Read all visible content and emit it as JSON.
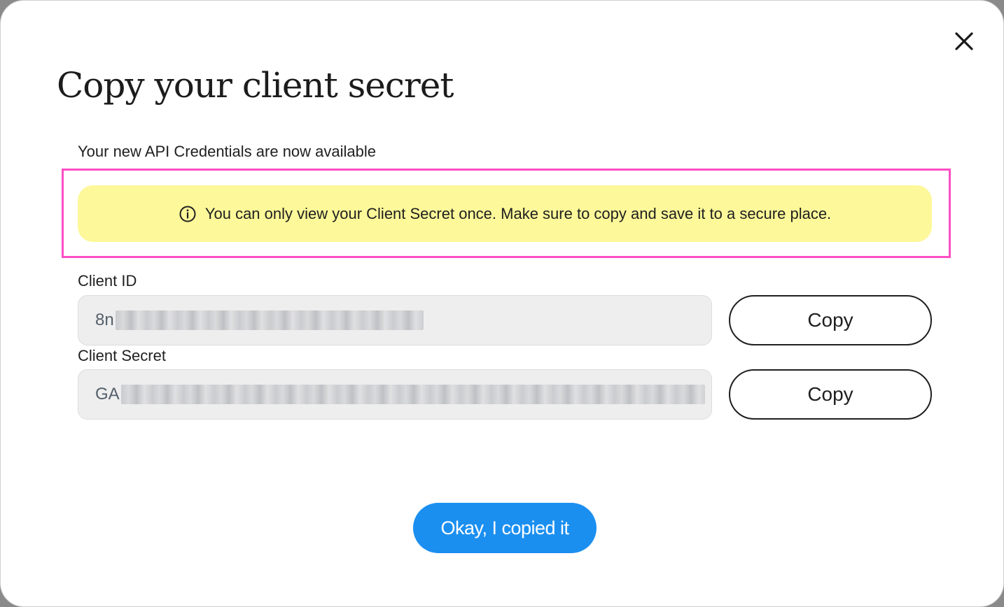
{
  "dialog": {
    "title": "Copy your client secret",
    "close_icon": "close-icon",
    "subtitle": "Your new API Credentials are now available",
    "warning": {
      "icon": "info-circle-icon",
      "text": "You can only view your Client Secret once. Make sure to copy and save it to a secure place."
    },
    "client_id": {
      "label": "Client ID",
      "visible_value": "8n",
      "copy_label": "Copy"
    },
    "client_secret": {
      "label": "Client Secret",
      "visible_value": "GA",
      "copy_label": "Copy"
    },
    "confirm_label": "Okay, I copied it"
  },
  "colors": {
    "warning_bg": "#fdf899",
    "highlight_border": "#ff4fc4",
    "primary": "#1b8ff0"
  }
}
